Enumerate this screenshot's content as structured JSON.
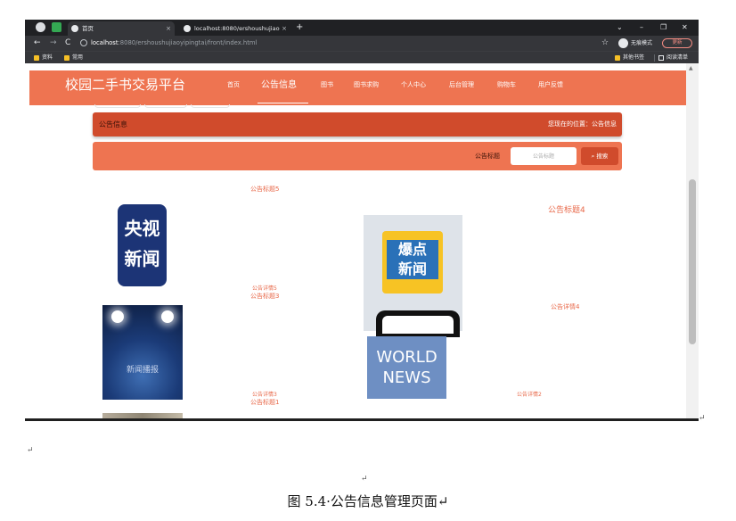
{
  "browser": {
    "tabs": [
      {
        "label": "首页",
        "active": true
      },
      {
        "label": "localhost:8080/ershoushujiao",
        "active": false
      }
    ],
    "tab_close": "×",
    "new_tab": "+",
    "window_controls": [
      "⌄",
      "–",
      "❐",
      "✕"
    ],
    "nav_buttons": [
      "←",
      "→",
      "C"
    ],
    "url_host": "localhost",
    "url_path": ":8080/ershoushujiaoyipingtai/front/index.html",
    "star": "☆",
    "incognito_label": "无痕模式",
    "update_button": "更新",
    "bookmarks": [
      "资料",
      "常用"
    ],
    "bookmarks_right": [
      "其他书签",
      "阅读清单"
    ]
  },
  "site": {
    "title": "校园二手书交易平台",
    "nav": [
      {
        "label": "首页",
        "active": false
      },
      {
        "label": "公告信息",
        "active": true
      },
      {
        "label": "图书",
        "active": false
      },
      {
        "label": "图书求购",
        "active": false
      },
      {
        "label": "个人中心",
        "active": false
      },
      {
        "label": "后台管理",
        "active": false
      },
      {
        "label": "购物车",
        "active": false
      },
      {
        "label": "用户反馈",
        "active": false
      }
    ],
    "breadcrumb_title": "公告信息",
    "breadcrumb_location": "您现在的位置：公告信息",
    "search_label": "公告标题",
    "search_placeholder": "公告标题",
    "search_button": "搜索"
  },
  "news": [
    {
      "title": "公告标题5",
      "detail": "公告详情5"
    },
    {
      "title": "公告标题4",
      "detail": "公告详情4"
    },
    {
      "title": "公告标题3",
      "detail": "公告详情3"
    },
    {
      "title": "",
      "detail": "公告详情2"
    },
    {
      "title": "公告标题1",
      "detail": ""
    }
  ],
  "images": {
    "cctv_line1": "央视",
    "cctv_line2": "新闻",
    "burst_line1": "爆点",
    "burst_line2": "新闻",
    "stage_text": "新闻播报",
    "world_line1": "WORLD",
    "world_line2": "NEWS"
  },
  "return_mark": "↵",
  "caption": "图 5.4·公告信息管理页面↵",
  "colors": {
    "nav_bg": "#ee7451",
    "breadcrumb_bg": "#d04b2c",
    "accent_text": "#e8694a",
    "chrome_dark": "#202124"
  }
}
